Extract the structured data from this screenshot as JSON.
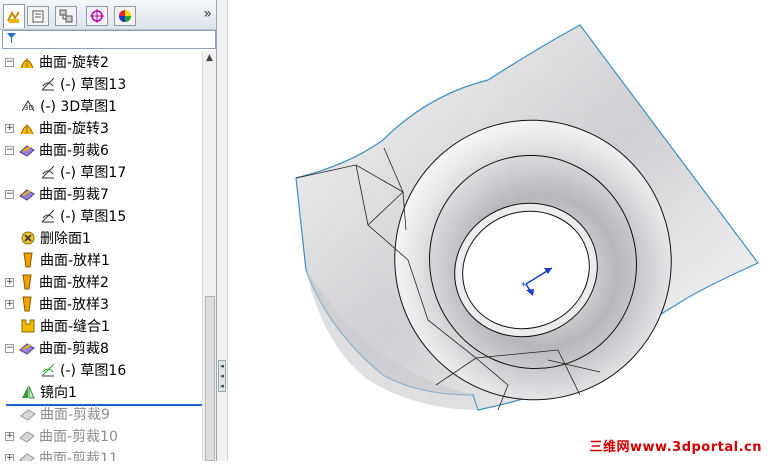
{
  "tabs": [
    {
      "name": "featuremanager",
      "icon": "feature-tree-icon"
    },
    {
      "name": "propertymanager",
      "icon": "property-manager-icon"
    },
    {
      "name": "configurationmanager",
      "icon": "configuration-icon"
    },
    {
      "name": "dimxpert",
      "icon": "dimxpert-icon"
    },
    {
      "name": "display",
      "icon": "display-manager-icon"
    }
  ],
  "expand_glyph": "»",
  "filter_icon": "filter-icon",
  "tree": [
    {
      "label": "曲面-旋转2",
      "icon": "revolve-surface-icon",
      "expander": "−"
    },
    {
      "label": "(-) 草图13",
      "icon": "sketch-icon"
    },
    {
      "label": "(-) 3D草图1",
      "icon": "3d-sketch-icon"
    },
    {
      "label": "曲面-旋转3",
      "icon": "revolve-surface-icon",
      "expander": "+"
    },
    {
      "label": "曲面-剪裁6",
      "icon": "trim-surface-icon",
      "expander": "−"
    },
    {
      "label": "(-) 草图17",
      "icon": "sketch-icon"
    },
    {
      "label": "曲面-剪裁7",
      "icon": "trim-surface-icon",
      "expander": "−"
    },
    {
      "label": "(-) 草图15",
      "icon": "sketch-icon"
    },
    {
      "label": "删除面1",
      "icon": "delete-face-icon"
    },
    {
      "label": "曲面-放样1",
      "icon": "loft-surface-icon"
    },
    {
      "label": "曲面-放样2",
      "icon": "loft-surface-icon",
      "expander": "+"
    },
    {
      "label": "曲面-放样3",
      "icon": "loft-surface-icon",
      "expander": "+"
    },
    {
      "label": "曲面-缝合1",
      "icon": "knit-surface-icon"
    },
    {
      "label": "曲面-剪裁8",
      "icon": "trim-surface-icon",
      "expander": "−"
    },
    {
      "label": "(-) 草图16",
      "icon": "sketch-icon"
    },
    {
      "label": "镜向1",
      "icon": "mirror-icon"
    },
    {
      "label": "曲面-剪裁9",
      "icon": "trim-surface-icon",
      "suppressed": true
    },
    {
      "label": "曲面-剪裁10",
      "icon": "trim-surface-icon",
      "suppressed": true,
      "expander": "+"
    },
    {
      "label": "曲面-剪裁11",
      "icon": "trim-surface-icon",
      "suppressed": true,
      "expander": "+"
    }
  ],
  "colors": {
    "rollback_bar": "#1e64c8",
    "surface_edge": "#3a8fc2",
    "triad": "#1a3ccc",
    "watermark": "#d10000"
  },
  "watermark": "三维网www.3dportal.cn"
}
